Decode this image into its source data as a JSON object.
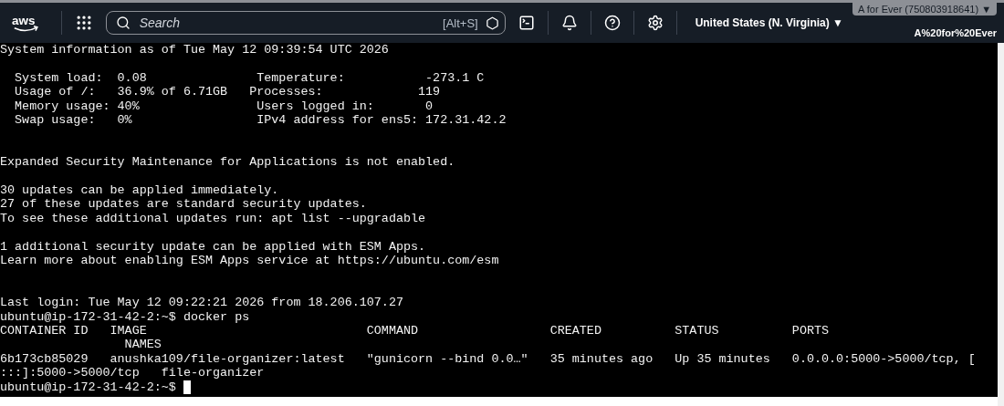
{
  "header": {
    "logo": "aws",
    "search": {
      "placeholder": "Search",
      "shortcut": "[Alt+S]"
    },
    "region": {
      "label": "United States (N. Virginia)",
      "caret": "▼"
    },
    "account": {
      "label": "A for Ever (750803918641)",
      "caret": "▼",
      "user": "A%20for%20Ever"
    }
  },
  "terminal": {
    "lines": [
      {
        "kind": "text",
        "text": "System information as of Tue May 12 09:39:54 UTC 2026"
      },
      {
        "kind": "blank"
      },
      {
        "kind": "text",
        "text": "  System load:  0.08               Temperature:           -273.1 C"
      },
      {
        "kind": "text",
        "text": "  Usage of /:   36.9% of 6.71GB   Processes:             119"
      },
      {
        "kind": "text",
        "text": "  Memory usage: 40%                Users logged in:       0"
      },
      {
        "kind": "text",
        "text": "  Swap usage:   0%                 IPv4 address for ens5: 172.31.42.2"
      },
      {
        "kind": "blank"
      },
      {
        "kind": "blank"
      },
      {
        "kind": "text",
        "text": "Expanded Security Maintenance for Applications is not enabled."
      },
      {
        "kind": "blank"
      },
      {
        "kind": "text",
        "text": "30 updates can be applied immediately."
      },
      {
        "kind": "text",
        "text": "27 of these updates are standard security updates."
      },
      {
        "kind": "text",
        "text": "To see these additional updates run: apt list --upgradable"
      },
      {
        "kind": "blank"
      },
      {
        "kind": "text",
        "text": "1 additional security update can be applied with ESM Apps."
      },
      {
        "kind": "text",
        "text": "Learn more about enabling ESM Apps service at https://ubuntu.com/esm"
      },
      {
        "kind": "blank"
      },
      {
        "kind": "blank"
      },
      {
        "kind": "text",
        "text": "Last login: Tue May 12 09:22:21 2026 from 18.206.107.27"
      },
      {
        "kind": "text",
        "text": "ubuntu@ip-172-31-42-2:~$ docker ps"
      },
      {
        "kind": "text",
        "text": "CONTAINER ID   IMAGE                              COMMAND                  CREATED          STATUS          PORTS"
      },
      {
        "kind": "text",
        "text": "                 NAMES"
      },
      {
        "kind": "text",
        "text": "6b173cb85029   anushka109/file-organizer:latest   \"gunicorn --bind 0.0…\"   35 minutes ago   Up 35 minutes   0.0.0.0:5000->5000/tcp, ["
      },
      {
        "kind": "text",
        "text": ":::]:5000->5000/tcp   file-organizer"
      },
      {
        "kind": "prompt",
        "text": "ubuntu@ip-172-31-42-2:~$"
      }
    ]
  }
}
